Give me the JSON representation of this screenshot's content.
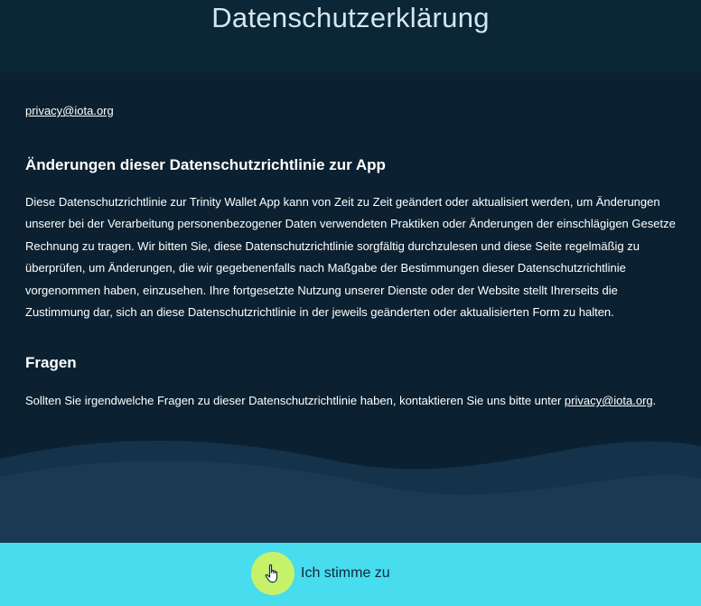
{
  "header": {
    "title": "Datenschutzerklärung"
  },
  "content": {
    "contact_email": "privacy@iota.org",
    "changes_heading": "Änderungen dieser Datenschutzrichtlinie zur App",
    "changes_text": "Diese Datenschutzrichtlinie zur Trinity Wallet App kann von Zeit zu Zeit geändert oder aktualisiert werden, um Änderungen unserer bei der Verarbeitung personenbezogener Daten verwendeten Praktiken oder Änderungen der einschlägigen Gesetze Rechnung zu tragen. Wir bitten Sie, diese Datenschutzrichtlinie sorgfältig durchzulesen und diese Seite regelmäßig zu überprüfen, um Änderungen, die wir gegebenenfalls nach Maßgabe der Bestimmungen dieser Datenschutzrichtlinie vorgenommen haben, einzusehen. Ihre fortgesetzte Nutzung unserer Dienste oder der Website stellt Ihrerseits die Zustimmung dar, sich an diese Datenschutzrichtlinie in der jeweils geänderten oder aktualisierten Form zu halten.",
    "questions_heading": "Fragen",
    "questions_text_before": "Sollten Sie irgendwelche Fragen zu dieser Datenschutzrichtlinie haben, kontaktieren Sie uns bitte unter ",
    "questions_email": "privacy@iota.org",
    "questions_text_after": "."
  },
  "footer": {
    "agree_label": "Ich stimme zu",
    "agree_icon": "hand-pointer-icon"
  },
  "colors": {
    "header_bg": "#0b2637",
    "content_bg": "#0b2131",
    "footer_bg": "#48dcef",
    "button_circle": "#c6f26a"
  }
}
